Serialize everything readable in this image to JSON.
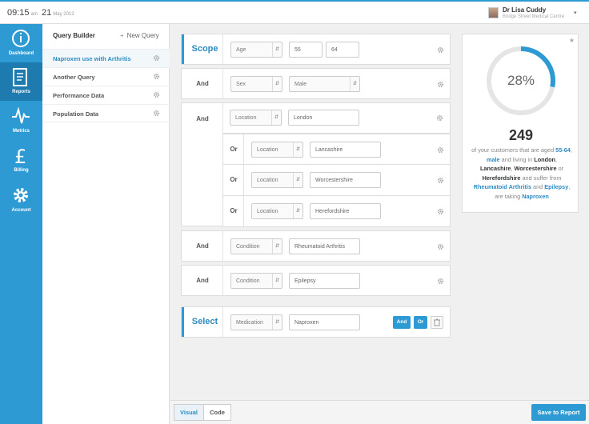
{
  "topbar": {
    "time": "09:15",
    "ampm": "am",
    "day": "21",
    "month_year": "May 2013",
    "user_name": "Dr Lisa Cuddy",
    "user_org": "Bridge Street Medical Centre"
  },
  "nav": [
    {
      "label": "Dashboard",
      "icon": "info-icon"
    },
    {
      "label": "Reports",
      "icon": "report-icon"
    },
    {
      "label": "Metrics",
      "icon": "pulse-icon"
    },
    {
      "label": "Billing",
      "icon": "pound-icon"
    },
    {
      "label": "Account",
      "icon": "gear-icon"
    }
  ],
  "query_panel": {
    "title": "Query Builder",
    "new_label": "New Query",
    "items": [
      {
        "label": "Naproxen use with Arthritis"
      },
      {
        "label": "Another Query"
      },
      {
        "label": "Performance Data"
      },
      {
        "label": "Population Data"
      }
    ]
  },
  "builder": {
    "scope": {
      "label": "Scope",
      "field": "Age",
      "min": "55",
      "max": "64"
    },
    "sex": {
      "label": "And",
      "field": "Sex",
      "value": "Male"
    },
    "location": {
      "label": "And",
      "field": "Location",
      "value": "London"
    },
    "or_rows": [
      {
        "label": "Or",
        "field": "Location",
        "value": "Lancashire"
      },
      {
        "label": "Or",
        "field": "Location",
        "value": "Worcestershire"
      },
      {
        "label": "Or",
        "field": "Location",
        "value": "Herefordshire"
      }
    ],
    "condition1": {
      "label": "And",
      "field": "Condition",
      "value": "Rheumatoid Arthritis"
    },
    "condition2": {
      "label": "And",
      "field": "Condition",
      "value": "Epilepsy"
    },
    "select": {
      "label": "Select",
      "field": "Medication",
      "value": "Naproxen",
      "and_btn": "And",
      "or_btn": "Or"
    }
  },
  "result": {
    "percent": "28%",
    "percent_value": 28,
    "count": "249",
    "t1": "of your customers that are aged",
    "age": "55-64",
    "t_comma": ",",
    "sex": "male",
    "t2": "and living in",
    "loc1": "London",
    "loc2": "Lancashire",
    "loc3": "Worcestershire",
    "t_or": "or",
    "loc4": "Herefordshire",
    "t3": "and suffer from",
    "cond1": "Rheumatoid Arthritis",
    "t_and": "and",
    "cond2": "Epilepsy",
    "t4": ", are taking",
    "med": "Naproxen"
  },
  "bottom": {
    "tab_visual": "Visual",
    "tab_code": "Code",
    "save": "Save to Report"
  },
  "colors": {
    "accent": "#2d9ad4",
    "accent_dark": "#1d7bb0",
    "ring_track": "#e5e5e5"
  }
}
